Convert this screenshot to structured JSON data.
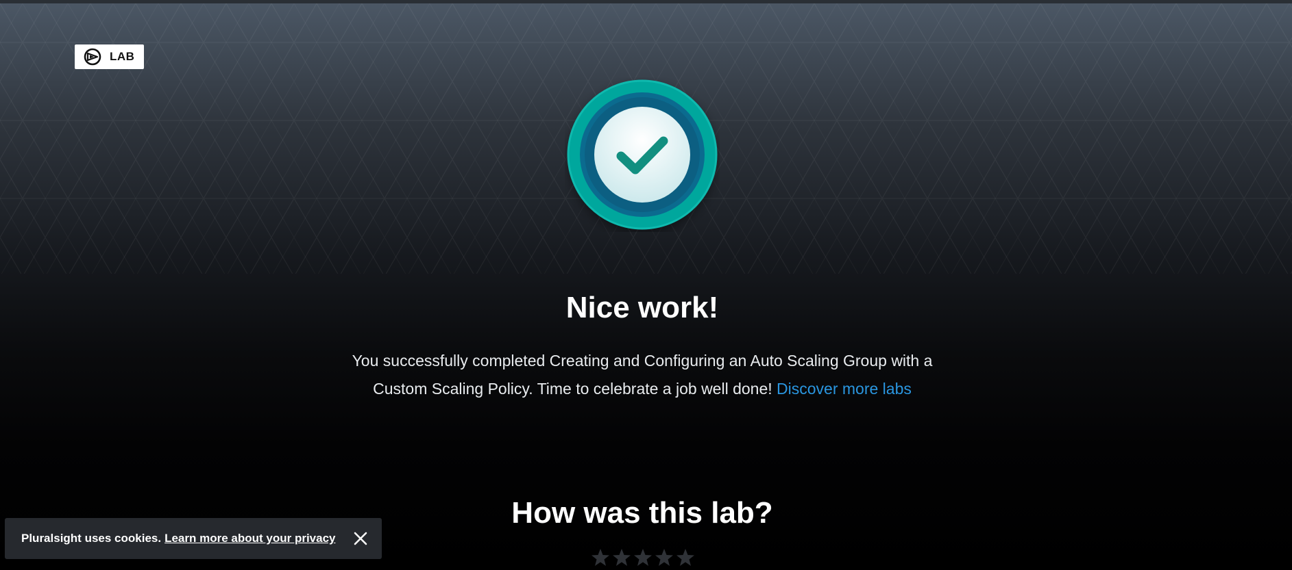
{
  "badge": {
    "label": "LAB",
    "icon": "pluralsight-logo-icon"
  },
  "completion": {
    "icon": "checkmark-medal-icon",
    "title": "Nice work!",
    "message": "You successfully completed Creating and Configuring an Auto Scaling Group with a Custom Scaling Policy. Time to celebrate a job well done!",
    "link_label": "Discover more labs"
  },
  "rating": {
    "title": "How was this lab?",
    "stars_total": 5,
    "stars_selected": 0,
    "star_icon": "star-icon"
  },
  "cookie_banner": {
    "text": "Pluralsight uses cookies.",
    "link_label": "Learn more about your privacy",
    "close_icon": "close-icon"
  },
  "colors": {
    "accent_link": "#2a96e0",
    "medal_outer": "#00a79d",
    "medal_inner": "#0b6b8f",
    "check": "#128f80"
  }
}
